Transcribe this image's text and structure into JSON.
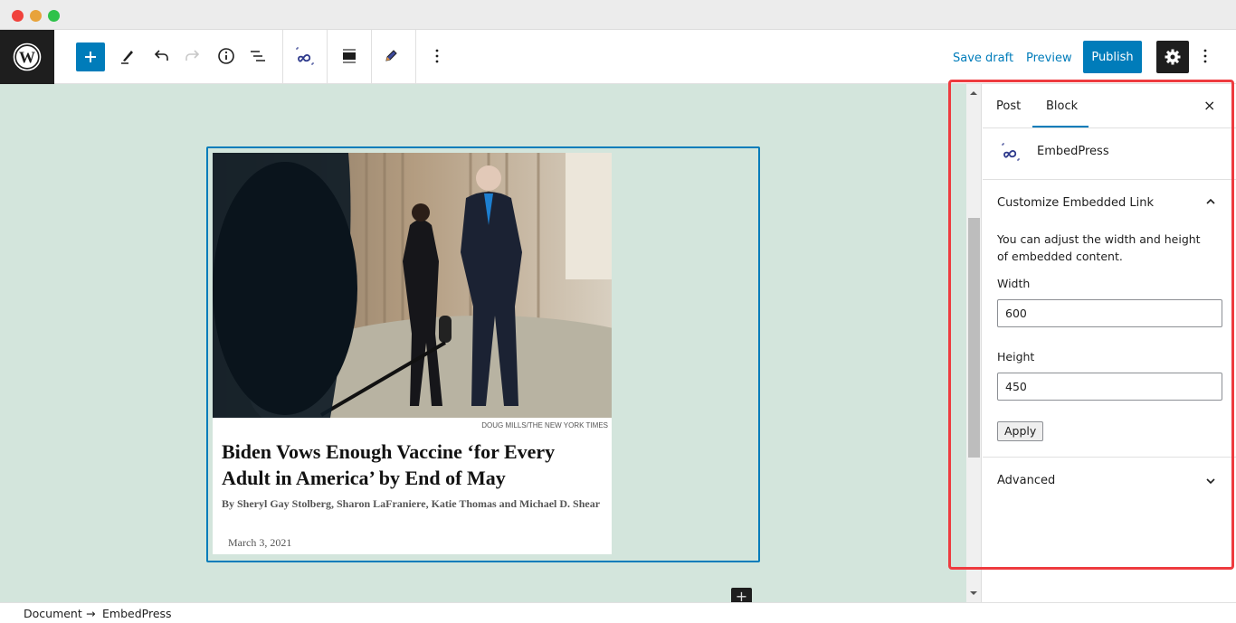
{
  "window": {
    "controls": [
      "close",
      "minimize",
      "maximize"
    ]
  },
  "toolbar": {
    "logo": "wordpress-logo",
    "add_block": "+",
    "tools": [
      "pencil-edit",
      "undo",
      "redo",
      "info",
      "list-view"
    ],
    "block_tools": [
      "embedpress",
      "align",
      "edit",
      "more-options"
    ],
    "save_draft": "Save draft",
    "preview": "Preview",
    "publish": "Publish",
    "settings": "gear",
    "more": "⋮"
  },
  "embed": {
    "photo_credit": "DOUG MILLS/THE NEW YORK TIMES",
    "headline": "Biden Vows Enough Vaccine ‘for Every Adult in America’ by End of May",
    "byline": "By Sheryl Gay Stolberg, Sharon LaFraniere, Katie Thomas and Michael D. Shear",
    "date": "March 3, 2021"
  },
  "sidebar": {
    "tabs": [
      {
        "label": "Post",
        "active": false
      },
      {
        "label": "Block",
        "active": true
      }
    ],
    "close": "×",
    "block_name": "EmbedPress",
    "panel_title": "Customize Embedded Link",
    "help_text": "You can adjust the width and height of embedded content.",
    "width_label": "Width",
    "width_value": "600",
    "height_label": "Height",
    "height_value": "450",
    "apply": "Apply",
    "advanced": "Advanced"
  },
  "breadcrumb": {
    "items": [
      "Document",
      "EmbedPress"
    ],
    "separator": "→"
  },
  "colors": {
    "accent": "#007cba",
    "canvas_bg": "#d3e5dc",
    "highlight": "#ee3b3f",
    "dark": "#1e1e1e"
  }
}
